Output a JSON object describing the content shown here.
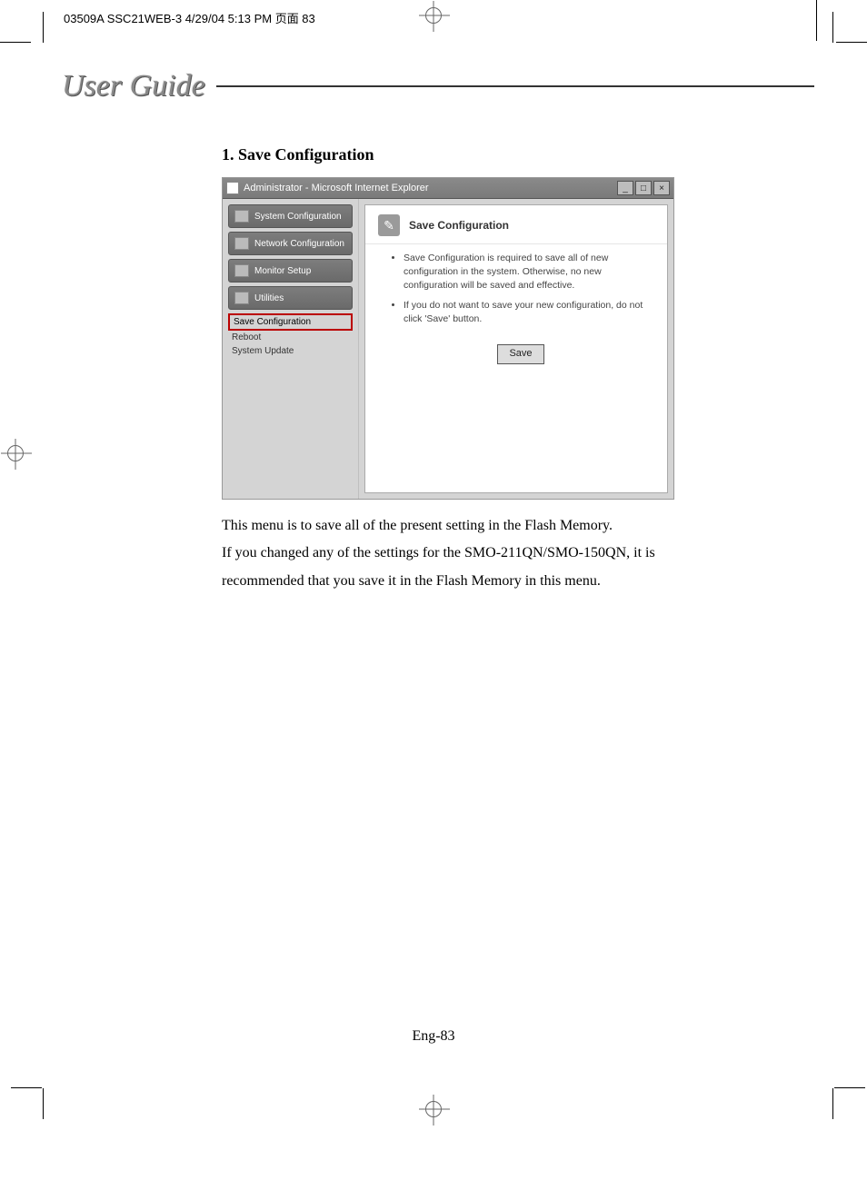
{
  "doc_header": "03509A SSC21WEB-3  4/29/04  5:13 PM  页面 83",
  "guide_title": "User Guide",
  "section_heading": "1. Save Configuration",
  "window": {
    "title": "Administrator - Microsoft Internet Explorer",
    "win_min": "_",
    "win_max": "□",
    "win_close": "×"
  },
  "sidebar": {
    "items": [
      "System Configuration",
      "Network Configuration",
      "Monitor Setup",
      "Utilities"
    ],
    "subitems": [
      "Save Configuration",
      "Reboot",
      "System Update"
    ]
  },
  "panel": {
    "title": "Save Configuration",
    "bullets": [
      "Save Configuration is required to save all of new configuration in the system. Otherwise, no new configuration will be saved and effective.",
      "If you do not want to save your new configuration, do not click 'Save' button."
    ],
    "save_btn": "Save"
  },
  "body_text_1": "This menu is to save all of the present setting in the Flash Memory.",
  "body_text_2": "If you changed any of the settings for the SMO-211QN/SMO-150QN, it is recommended that you save it in the Flash Memory in this menu.",
  "page_number": "Eng-83"
}
